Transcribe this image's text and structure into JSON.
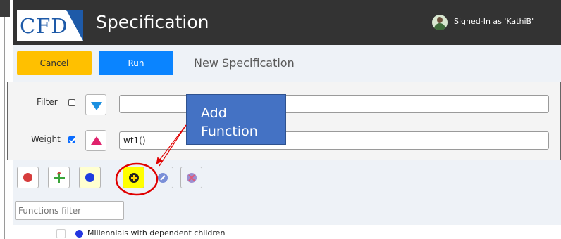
{
  "header": {
    "logo_text": "CFD",
    "title": "Specification",
    "signed_in": "Signed-In as 'KathiB'"
  },
  "toolbar": {
    "cancel_label": "Cancel",
    "run_label": "Run",
    "spec_title": "New Specification"
  },
  "panel": {
    "filter_label": "Filter",
    "filter_checked": false,
    "filter_value": "",
    "weight_label": "Weight",
    "weight_checked": true,
    "weight_value": "wt1()"
  },
  "callout": {
    "line1": "Add",
    "line2": "Function"
  },
  "icons": [
    "remove-icon",
    "move-icon",
    "circle-icon",
    "add-function-icon",
    "edit-function-icon",
    "delete-function-icon"
  ],
  "functions_filter": {
    "placeholder": "Functions filter",
    "value": ""
  },
  "list": [
    {
      "label": "Millennials with dependent children",
      "checked": false
    }
  ],
  "colors": {
    "header_bg": "#333333",
    "cancel": "#ffc000",
    "run": "#0a84ff",
    "callout": "#4472c4",
    "highlight": "#ffff00",
    "annotation": "#e00000"
  }
}
